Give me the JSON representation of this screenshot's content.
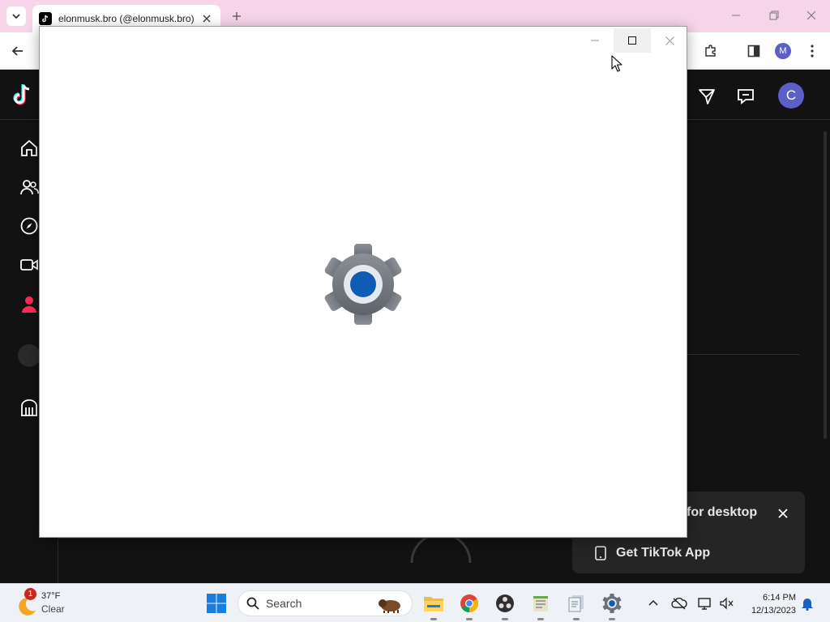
{
  "browser": {
    "tab": {
      "title": "elonmusk.bro (@elonmusk.bro)"
    },
    "profile_initial": "M"
  },
  "tiktok": {
    "avatar_initial": "C",
    "promo": {
      "title": "for desktop",
      "app_button_label": "Get TikTok App"
    }
  },
  "settings_window": {
    "state": "loading splash",
    "icon": "settings-gear-icon"
  },
  "taskbar": {
    "weather": {
      "temp": "37°F",
      "condition": "Clear",
      "badge": "1"
    },
    "search_placeholder": "Search",
    "clock": {
      "time": "6:14 PM",
      "date": "12/13/2023"
    }
  },
  "colors": {
    "tab_strip": "#f6d4e9",
    "tiktok_bg": "#121212",
    "accent_blue": "#0f5cb5",
    "tiktok_pink": "#fe2c55",
    "avatar_purple": "#5b5fc7"
  }
}
